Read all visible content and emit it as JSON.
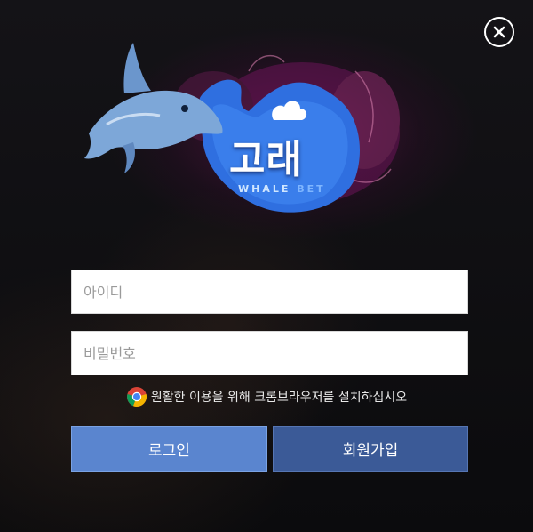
{
  "dialog": {
    "close_icon": "close-icon",
    "logo": {
      "title": "고래",
      "subtitle_whale": "WHALE",
      "subtitle_bet": "BET"
    },
    "login_form": {
      "id_placeholder": "아이디",
      "password_placeholder": "비밀번호",
      "id_value": "",
      "password_value": "",
      "browser_hint_icon": "chrome-icon",
      "browser_hint": "원활한 이용을 위해 크롬브라우저를 설치하십시오",
      "login_label": "로그인",
      "signup_label": "회원가입"
    }
  },
  "colors": {
    "login_button": "#5a85cf",
    "signup_button": "#3b5a97",
    "logo_blue": "#2f6fe0"
  }
}
